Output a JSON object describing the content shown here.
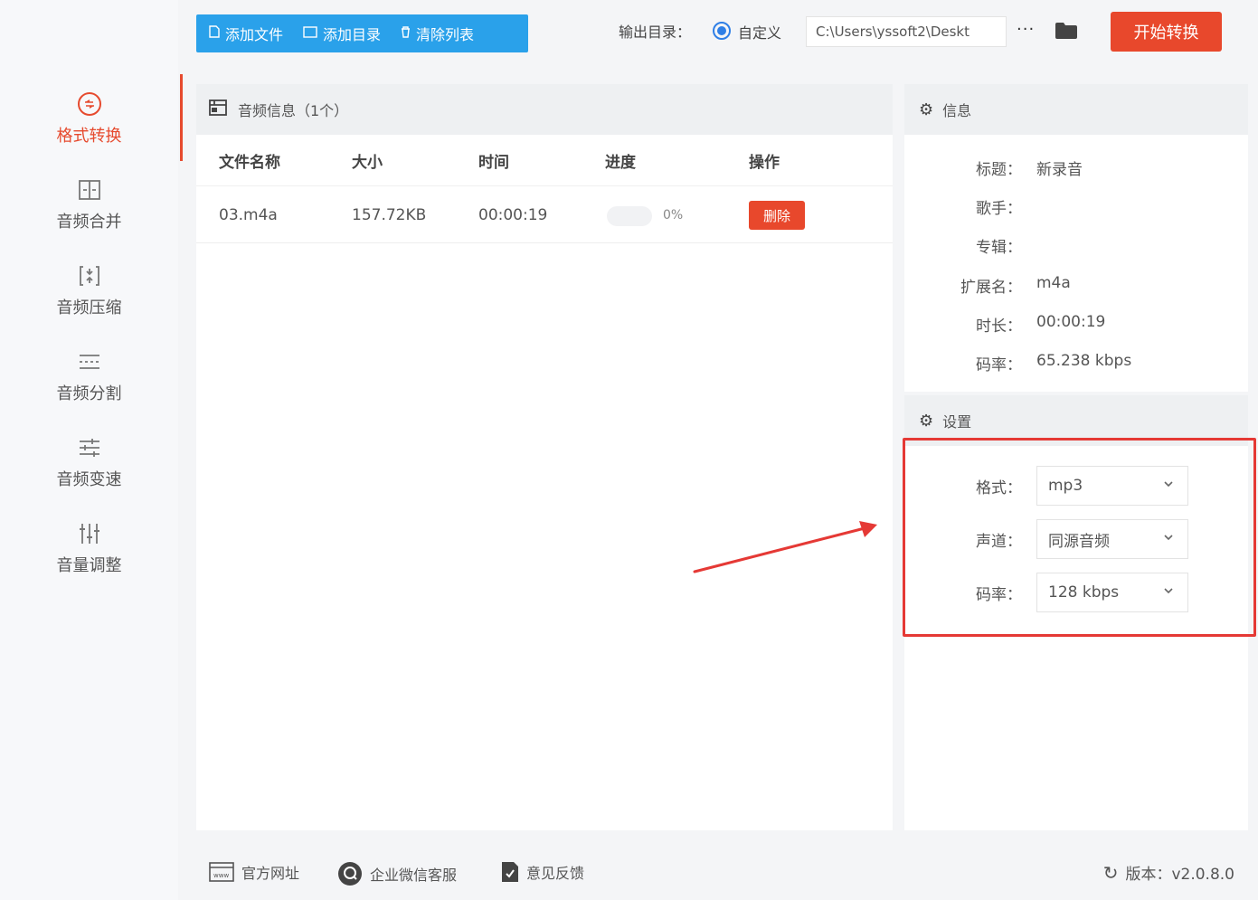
{
  "sidebar": {
    "items": [
      {
        "label": "格式转换",
        "icon": "convert-icon",
        "active": true
      },
      {
        "label": "音频合并",
        "icon": "merge-icon"
      },
      {
        "label": "音频压缩",
        "icon": "compress-icon"
      },
      {
        "label": "音频分割",
        "icon": "split-icon"
      },
      {
        "label": "音频变速",
        "icon": "speed-icon"
      },
      {
        "label": "音量调整",
        "icon": "volume-icon"
      }
    ]
  },
  "toolbar": {
    "add_file": "添加文件",
    "add_dir": "添加目录",
    "clear_list": "清除列表",
    "output_label": "输出目录：",
    "radio_custom": "自定义",
    "output_path": "C:\\Users\\yssoft2\\Deskt",
    "more": "···",
    "start": "开始转换"
  },
  "file_panel": {
    "title": "音频信息（1个）",
    "columns": [
      "文件名称",
      "大小",
      "时间",
      "进度",
      "操作"
    ],
    "rows": [
      {
        "name": "03.m4a",
        "size": "157.72KB",
        "time": "00:00:19",
        "progress": 0,
        "progress_text": "0%",
        "action": "删除"
      }
    ]
  },
  "info": {
    "title": "信息",
    "fields": [
      {
        "key": "标题：",
        "value": "新录音"
      },
      {
        "key": "歌手：",
        "value": ""
      },
      {
        "key": "专辑：",
        "value": ""
      },
      {
        "key": "扩展名：",
        "value": "m4a"
      },
      {
        "key": "时长：",
        "value": "00:00:19"
      },
      {
        "key": "码率：",
        "value": "65.238 kbps"
      }
    ]
  },
  "settings": {
    "title": "设置",
    "fields": [
      {
        "key": "格式：",
        "value": "mp3"
      },
      {
        "key": "声道：",
        "value": "同源音频"
      },
      {
        "key": "码率：",
        "value": "128 kbps"
      }
    ]
  },
  "footer": {
    "website": "官方网址",
    "wechat": "企业微信客服",
    "feedback": "意见反馈",
    "version": "版本：v2.0.8.0"
  },
  "colors": {
    "accent": "#e8482c",
    "primary": "#2aa1ea",
    "highlight": "#e53935"
  }
}
